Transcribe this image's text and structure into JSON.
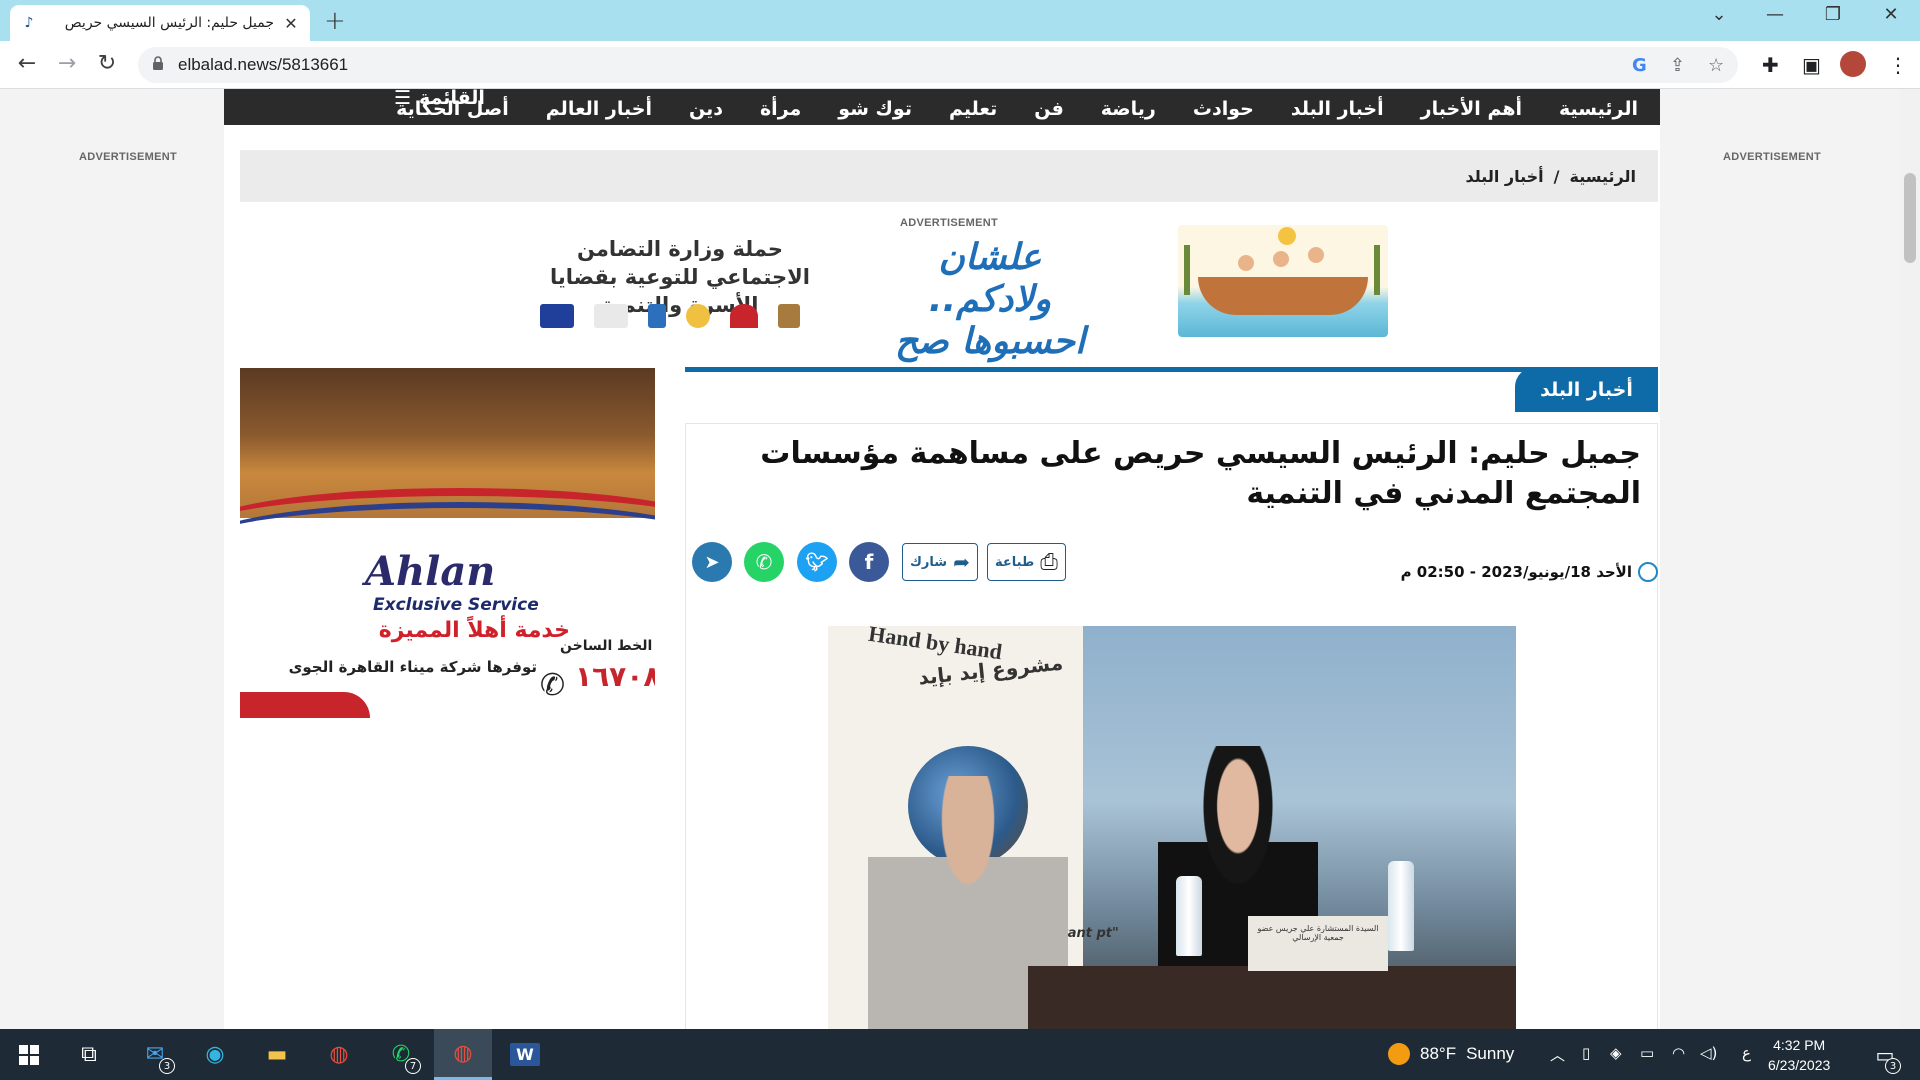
{
  "browser": {
    "tab_title": "جميل حليم: الرئيس السيسي حريص",
    "new_tab_symbol": "+",
    "url": "elbalad.news/5813661"
  },
  "site_nav": {
    "items": [
      "الرئيسية",
      "أهم الأخبار",
      "أخبار البلد",
      "حوادث",
      "رياضة",
      "فن",
      "تعليم",
      "توك شو",
      "مرأة",
      "دين",
      "أخبار العالم",
      "أصل الحكاية"
    ],
    "menu_label": "القائمة"
  },
  "ads": {
    "label": "ADVERTISEMENT",
    "banner_text": "حملة وزارة التضامن الاجتماعي للتوعية بقضايا الأسرة والتنمية",
    "banner_slogan": "علشان ولادكم.. احسبوها صح",
    "side": {
      "brand": "Ahlan",
      "tagline": "Exclusive Service",
      "arabic_title": "خدمة أهلاً المميزة",
      "arabic_sub": "توفرها شركة ميناء القاهرة الجوى",
      "hotline_label": "الخط الساخن",
      "hotline_number": "١٦٧٠٨"
    }
  },
  "breadcrumb": {
    "home": "الرئيسية",
    "separator": "/",
    "section": "أخبار البلد"
  },
  "article": {
    "section": "أخبار البلد",
    "headline": "جميل حليم: الرئيس السيسي حريص على مساهمة مؤسسات المجتمع المدني في التنمية",
    "date": "الأحد 18/يونيو/2023 - 02:50 م",
    "print_label": "طباعة",
    "share_label": "شارك",
    "photo": {
      "stand_text_en": "Hand by hand",
      "stand_text_ar": "مشروع إيد بإيد",
      "stand_text_partial": "migrant\npt\"",
      "nameplate": "السيدة المستشارة علي جريس عضو جمعية الإرسالي"
    }
  },
  "taskbar": {
    "mail_badge": "3",
    "whatsapp_badge": "7",
    "weather_temp": "88°F",
    "weather_desc": "Sunny",
    "lang": "ع",
    "time": "4:32 PM",
    "date": "6/23/2023",
    "notif_count": "3"
  },
  "colors": {
    "tabbar": "#a9e0f0",
    "site_nav": "#2b2b2b",
    "section_blue": "#0f6aa8",
    "facebook": "#3b5998",
    "twitter": "#1da1f2",
    "whatsapp": "#25d366",
    "telegram": "#2a7ab0",
    "taskbar": "#1e2b36"
  }
}
